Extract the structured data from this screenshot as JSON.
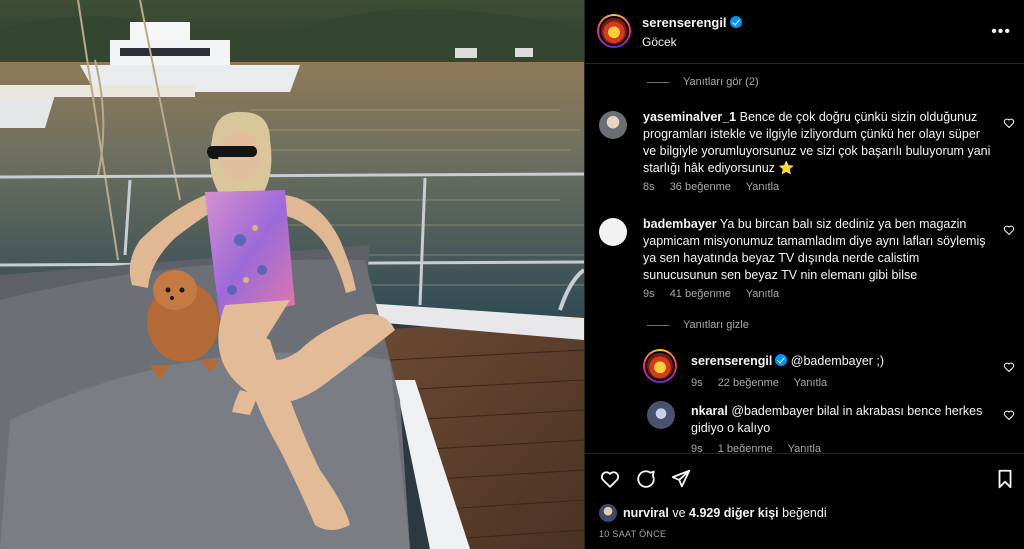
{
  "post": {
    "username": "serenserengil",
    "location": "Göcek",
    "more_icon": "more-horizontal-icon"
  },
  "comments": {
    "view_replies": "Yanıtları gör (2)",
    "items": [
      {
        "username": "yaseminalver_1",
        "text": "Bence de çok doğru çünkü sizin olduğunuz programları istekle ve ilgiyle izliyordum çünkü her olayı süper ve bilgiyle yorumluyorsunuz ve sizi çok başarılı buluyorum yani starlığı hâk ediyorsunuz ⭐",
        "time": "8s",
        "likes": "36 beğenme",
        "reply": "Yanıtla"
      },
      {
        "username": "badembayer",
        "text": "Ya bu bircan balı siz dediniz ya ben magazin yapmicam misyonumuz tamamladım diye aynı lafları söylemiş ya sen hayatında beyaz TV dışında nerde calistim sunucusunun sen beyaz TV nin elemanı gibi bilse",
        "time": "9s",
        "likes": "41 beğenme",
        "reply": "Yanıtla"
      }
    ],
    "hide_replies": "Yanıtları gizle",
    "replies": [
      {
        "username": "serenserengil",
        "text": "@badembayer ;)",
        "time": "9s",
        "likes": "22 beğenme",
        "reply": "Yanıtla"
      },
      {
        "username": "nkaral",
        "text": "@badembayer bilal in akrabası bence herkes gidiyo o kalıyo",
        "time": "9s",
        "likes": "1 beğenme",
        "reply": "Yanıtla"
      }
    ]
  },
  "footer": {
    "liked_by_user": "nurviral",
    "liked_by_joiner": " ve ",
    "liked_by_others": "4.929 diğer kişi",
    "liked_by_suffix": " beğendi",
    "time_ago": "10 SAAT ÖNCE"
  },
  "colors": {
    "accent": "#0095f6",
    "bg": "#000000",
    "muted": "#a8a8a8",
    "divider": "#262626"
  }
}
